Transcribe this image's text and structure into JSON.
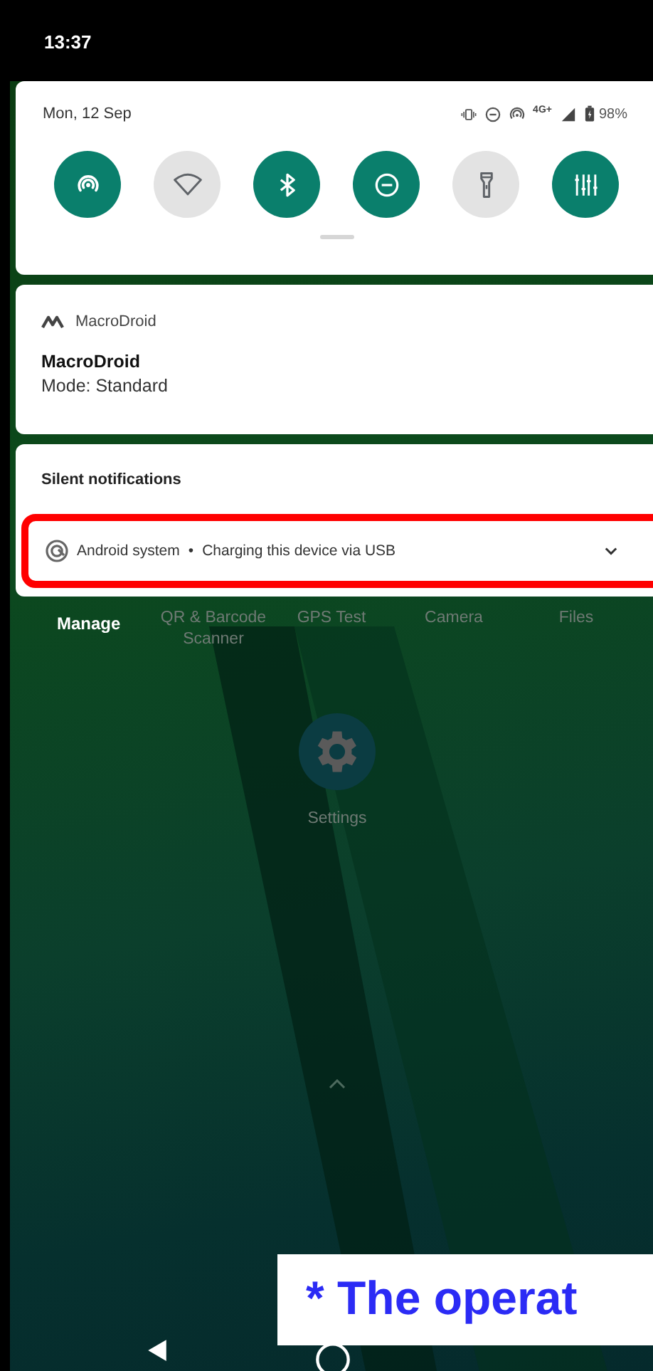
{
  "status_bar": {
    "time": "13:37"
  },
  "quick_settings": {
    "date": "Mon, 12 Sep",
    "network": "4G+",
    "battery": "98%",
    "tiles": [
      {
        "kind": "hotspot",
        "on": true
      },
      {
        "kind": "wifi",
        "on": false
      },
      {
        "kind": "bluetooth",
        "on": true
      },
      {
        "kind": "dnd",
        "on": true
      },
      {
        "kind": "flashlight",
        "on": false
      },
      {
        "kind": "equalizer",
        "on": true
      }
    ]
  },
  "notifications": [
    {
      "app": "MacroDroid",
      "title": "MacroDroid",
      "text": "Mode: Standard"
    }
  ],
  "silent_section": {
    "header": "Silent notifications",
    "items": [
      {
        "app": "Android system",
        "separator": "•",
        "text": "Charging this device via USB",
        "highlighted": true
      }
    ]
  },
  "manage_button": "Manage",
  "home_apps": [
    {
      "label": "QR & Barcode Scanner"
    },
    {
      "label": "GPS Test"
    },
    {
      "label": "Camera"
    },
    {
      "label": "Files"
    }
  ],
  "settings_app": {
    "label": "Settings"
  },
  "caption": "* The operat"
}
